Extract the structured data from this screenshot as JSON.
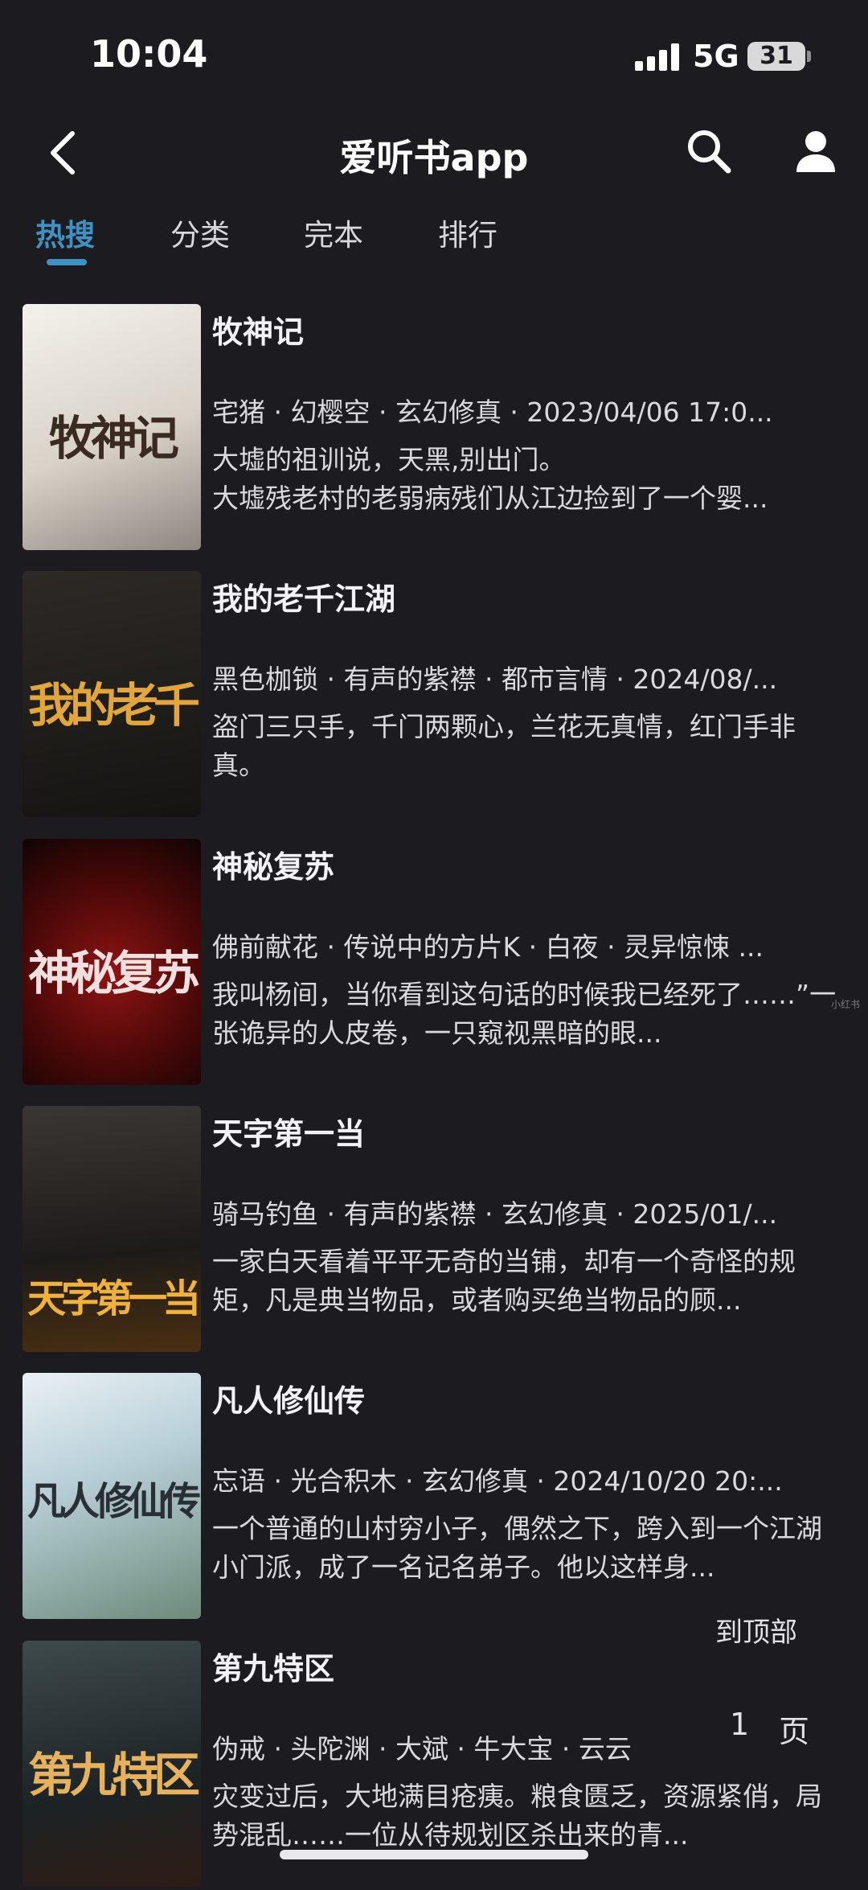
{
  "status_bar": {
    "time": "10:04",
    "network": "5G",
    "battery": "31"
  },
  "header": {
    "title": "爱听书app",
    "back_icon": "chevron-left-icon",
    "search_icon": "search-icon",
    "user_icon": "user-icon"
  },
  "tabs": [
    {
      "label": "热搜",
      "active": true
    },
    {
      "label": "分类",
      "active": false
    },
    {
      "label": "完本",
      "active": false
    },
    {
      "label": "排行",
      "active": false
    }
  ],
  "books": [
    {
      "title": "牧神记",
      "meta": "宅猪 · 幻樱空 · 玄幻修真 · 2023/04/06 17:0...",
      "desc": "大墟的祖训说，天黑,别出门。\n大墟残老村的老弱病残们从江边捡到了一个婴...",
      "cover_text": "牧神记"
    },
    {
      "title": "我的老千江湖",
      "meta": "黑色枷锁 · 有声的紫襟 · 都市言情 · 2024/08/...",
      "desc": "盗门三只手，千门两颗心，兰花无真情，红门手非真。",
      "cover_text": "我的老千"
    },
    {
      "title": "神秘复苏",
      "meta": "佛前献花 · 传说中的方片K · 白夜 · 灵异惊悚 ...",
      "desc": "我叫杨间，当你看到这句话的时候我已经死了……”一张诡异的人皮卷，一只窥视黑暗的眼...",
      "cover_text": "神秘复苏"
    },
    {
      "title": "天字第一当",
      "meta": "骑马钓鱼 · 有声的紫襟 · 玄幻修真 · 2025/01/...",
      "desc": "一家白天看着平平无奇的当铺，却有一个奇怪的规矩，凡是典当物品，或者购买绝当物品的顾...",
      "cover_text": "天字第一当"
    },
    {
      "title": "凡人修仙传",
      "meta": "忘语 · 光合积木 · 玄幻修真 · 2024/10/20 20:...",
      "desc": "一个普通的山村穷小子，偶然之下，跨入到一个江湖小门派，成了一名记名弟子。他以这样身...",
      "cover_text": "凡人修仙传"
    },
    {
      "title": "第九特区",
      "meta": "伪戒 · 头陀渊 · 大斌 · 牛大宝 · 云云",
      "desc": "灾变过后，大地满目疮痍。粮食匮乏，资源紧俏，局势混乱……一位从待规划区杀出来的青...",
      "cover_text": "第九特区"
    }
  ],
  "floating": {
    "to_top": "到顶部",
    "page_number": "1",
    "page_unit": "页"
  },
  "watermark": "小红书"
}
